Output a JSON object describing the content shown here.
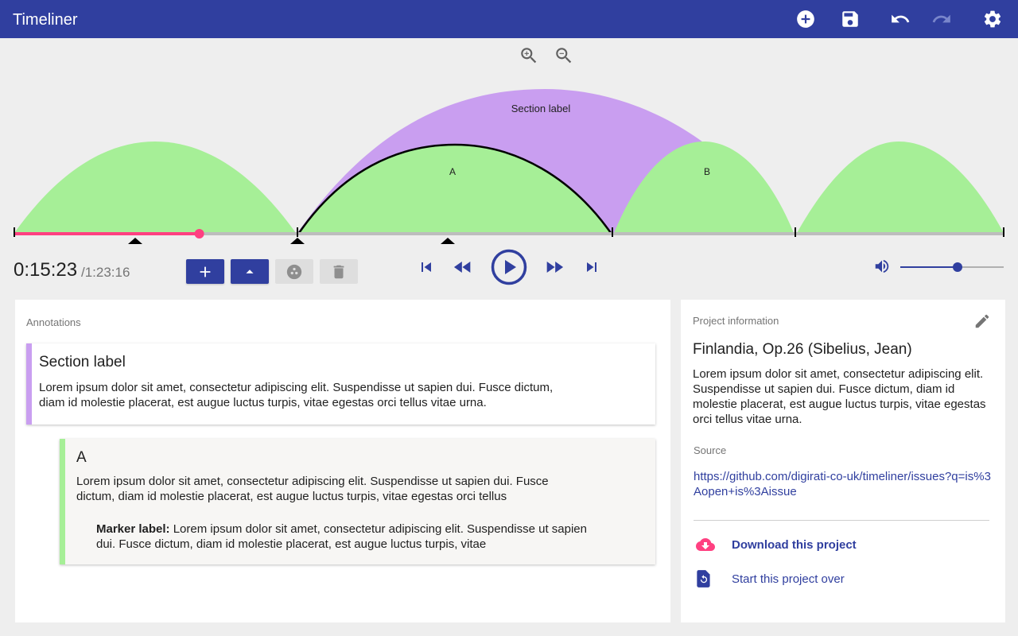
{
  "app": {
    "title": "Timeliner"
  },
  "colors": {
    "primary": "#303f9f",
    "accent": "#ff4081",
    "section": "#c99ef0",
    "segment": "#a6ef97"
  },
  "toolbar": {
    "icons": [
      "add-circle-icon",
      "save-icon",
      "undo-icon",
      "redo-icon",
      "settings-icon"
    ]
  },
  "timeline": {
    "section_label": "Section label",
    "segment_a_label": "A",
    "segment_b_label": "B",
    "playhead_progress": 0.187
  },
  "player": {
    "current_time": "0:15:23",
    "total_time": "/1:23:16",
    "volume": 0.55
  },
  "annotations": {
    "heading": "Annotations",
    "section_card": {
      "title": "Section label",
      "body": "Lorem ipsum dolor sit amet, consectetur adipiscing elit. Suspendisse ut sapien dui. Fusce dictum, diam id molestie placerat, est augue luctus turpis, vitae egestas orci tellus vitae urna."
    },
    "segment_card": {
      "title": "A",
      "body": "Lorem ipsum dolor sit amet, consectetur adipiscing elit. Suspendisse ut sapien dui. Fusce dictum, diam id molestie placerat, est augue luctus turpis, vitae egestas orci tellus",
      "marker_label": "Marker label:",
      "marker_body": " Lorem ipsum dolor sit amet, consectetur adipiscing elit. Suspendisse ut sapien dui. Fusce dictum, diam id molestie placerat, est augue luctus turpis, vitae"
    }
  },
  "project": {
    "heading": "Project information",
    "title": "Finlandia, Op.26 (Sibelius, Jean)",
    "description": "Lorem ipsum dolor sit amet, consectetur adipiscing elit. Suspendisse ut sapien dui. Fusce dictum, diam id molestie placerat, est augue luctus turpis, vitae egestas orci tellus vitae urna.",
    "source_heading": "Source",
    "source_url": "https://github.com/digirati-co-uk/timeliner/issues?q=is%3Aopen+is%3Aissue",
    "download_label": "Download this project",
    "start_over_label": "Start this project over"
  }
}
